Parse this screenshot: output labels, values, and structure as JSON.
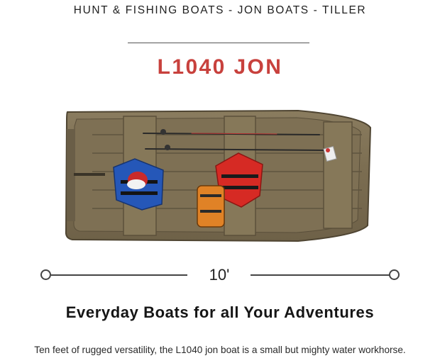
{
  "breadcrumb": "HUNT & FISHING BOATS - JON BOATS - TILLER",
  "model_title": "L1040 JON",
  "length_scale": {
    "label": "10'"
  },
  "tagline": "Everyday Boats for all Your Adventures",
  "description": "Ten feet of rugged versatility, the L1040 jon boat is a small but mighty water workhorse.",
  "colors": {
    "accent": "#c8413d",
    "hull": "#7d6f53",
    "hull_dark": "#5f533d",
    "life_jacket_blue": "#2557b8",
    "life_jacket_red": "#d62a24",
    "bag_orange": "#e08226"
  },
  "image": {
    "subject": "top-down view of L1040 jon boat with fishing rods, life jackets and tackle bag"
  }
}
